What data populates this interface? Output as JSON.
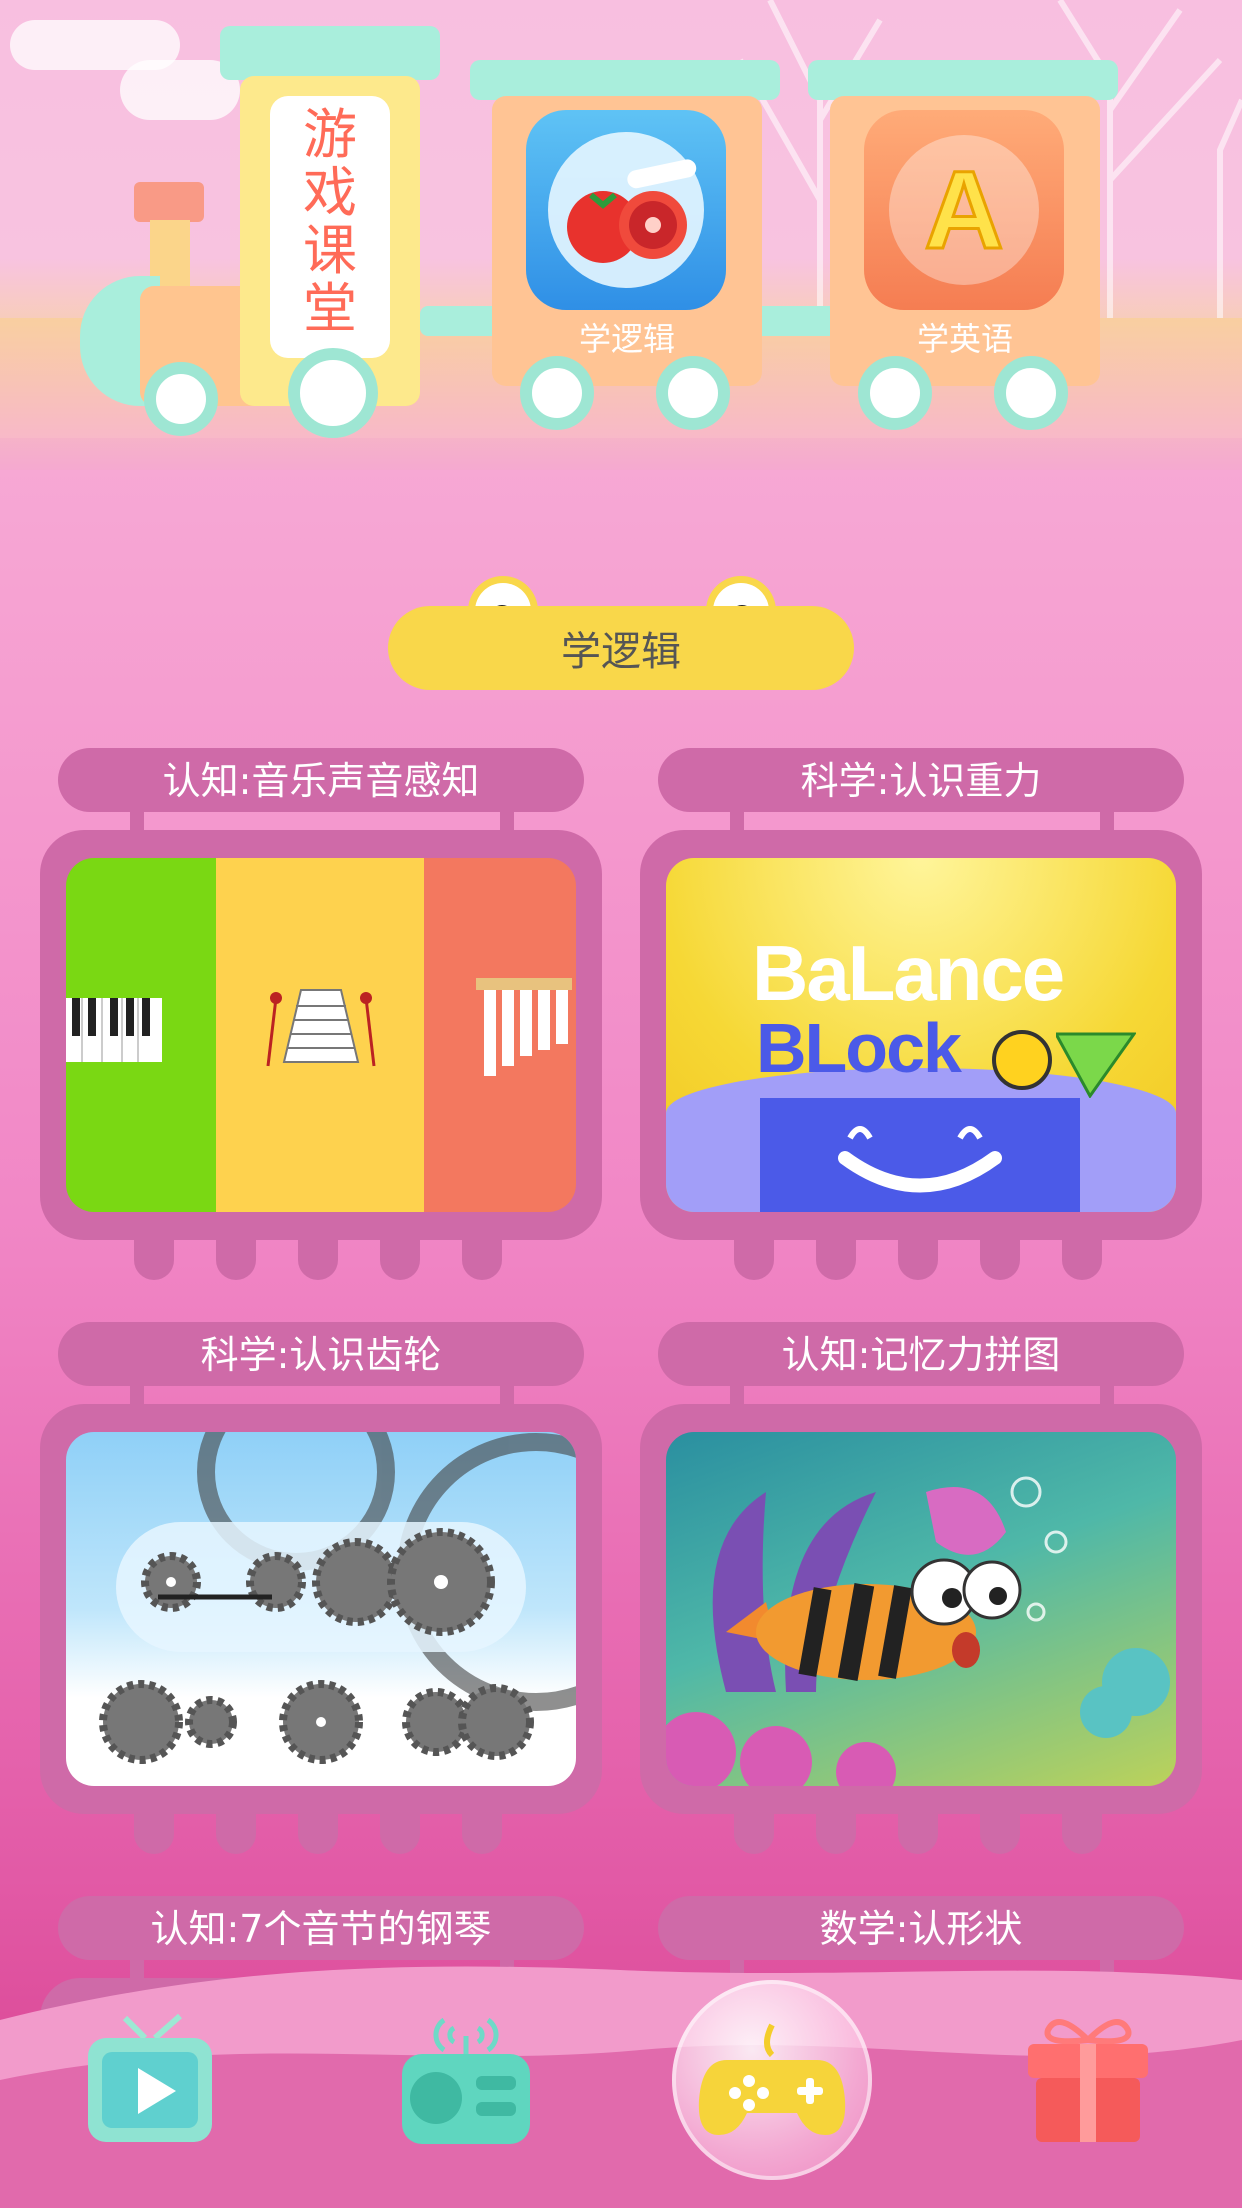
{
  "banner": {
    "title_chars": [
      "游",
      "戏",
      "课",
      "堂"
    ],
    "cars": [
      {
        "label": "学逻辑",
        "icon": "tomato-icon"
      },
      {
        "label": "学英语",
        "icon": "letter-a-icon",
        "letter": "A"
      }
    ]
  },
  "section": {
    "title": "学逻辑"
  },
  "games": [
    {
      "label": "认知:音乐声音感知"
    },
    {
      "label": "科学:认识重力",
      "art_text_1": "BaLance",
      "art_text_2": "BLock"
    },
    {
      "label": "科学:认识齿轮"
    },
    {
      "label": "认知:记忆力拼图"
    },
    {
      "label": "认知:7个音节的钢琴"
    },
    {
      "label": "数学:认形状"
    }
  ],
  "nav": [
    {
      "icon": "tv-icon"
    },
    {
      "icon": "radio-icon"
    },
    {
      "icon": "gamepad-icon",
      "active": true
    },
    {
      "icon": "gift-icon"
    }
  ],
  "colors": {
    "accent_yellow": "#f9d74a",
    "card_pink": "#cf6aa8",
    "mint": "#9ee6d3"
  }
}
